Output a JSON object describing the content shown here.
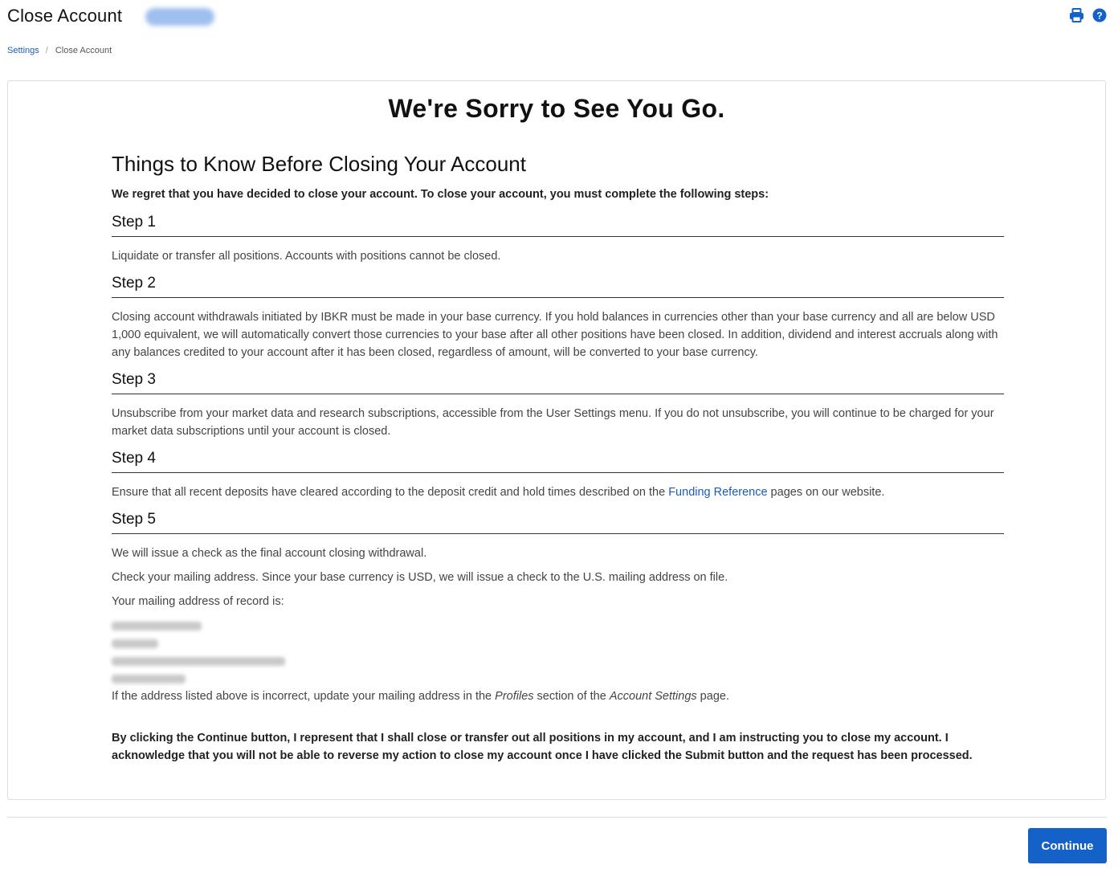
{
  "header": {
    "title": "Close Account",
    "icons": [
      "printer-icon",
      "help-icon"
    ]
  },
  "breadcrumb": {
    "parent": "Settings",
    "separator": "/",
    "current": "Close Account"
  },
  "main": {
    "headline": "We're Sorry to See You Go.",
    "subheading": "Things to Know Before Closing Your Account",
    "intro": "We regret that you have decided to close your account. To close your account, you must complete the following steps:",
    "steps": [
      {
        "title": "Step 1",
        "text": "Liquidate or transfer all positions. Accounts with positions cannot be closed."
      },
      {
        "title": "Step 2",
        "text": "Closing account withdrawals initiated by IBKR must be made in your base currency. If you hold balances in currencies other than your base currency and all are below USD 1,000 equivalent, we will automatically convert those currencies to your base after all other positions have been closed. In addition, dividend and interest accruals along with any balances credited to your account after it has been closed, regardless of amount, will be converted to your base currency."
      },
      {
        "title": "Step 3",
        "text": "Unsubscribe from your market data and research subscriptions, accessible from the User Settings menu. If you do not unsubscribe, you will continue to be charged for your market data subscriptions until your account is closed."
      },
      {
        "title": "Step 4",
        "text_before": "Ensure that all recent deposits have cleared according to the deposit credit and hold times described on the ",
        "link": "Funding Reference",
        "text_after": " pages on our website."
      },
      {
        "title": "Step 5",
        "line1": "We will issue a check as the final account closing withdrawal.",
        "line2": "Check your mailing address. Since your base currency is USD, we will issue a check to the U.S. mailing address on file.",
        "line3": "Your mailing address of record is:",
        "update_before": "If the address listed above is incorrect, update your mailing address in the ",
        "update_profiles": "Profiles",
        "update_middle": " section of the ",
        "update_settings": "Account Settings",
        "update_after": " page."
      }
    ],
    "acknowledgement": "By clicking the Continue button, I represent that I shall close or transfer out all positions in my account, and I am instructing you to close my account. I acknowledge that you will not be able to reverse my action to close my account once I have clicked the Submit button and the request has been processed."
  },
  "footer": {
    "continue_label": "Continue",
    "accent_color": "#1461c8"
  }
}
